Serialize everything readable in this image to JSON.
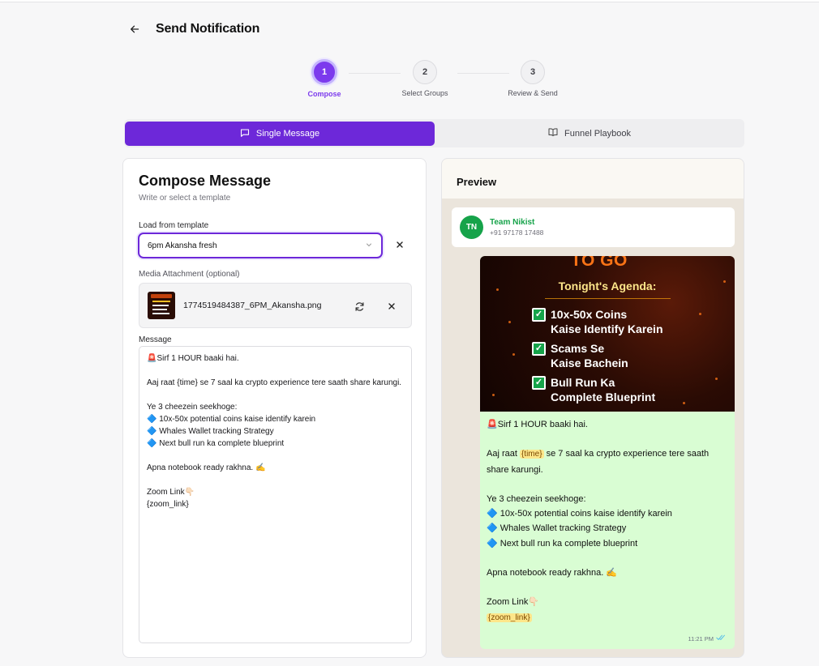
{
  "page": {
    "title": "Send Notification"
  },
  "steps": [
    {
      "number": "1",
      "label": "Compose"
    },
    {
      "number": "2",
      "label": "Select Groups"
    },
    {
      "number": "3",
      "label": "Review & Send"
    }
  ],
  "mode_tabs": {
    "single": "Single Message",
    "funnel": "Funnel Playbook"
  },
  "compose": {
    "heading": "Compose Message",
    "subheading": "Write or select a template",
    "template_label": "Load from template",
    "template_value": "6pm Akansha fresh",
    "media_label": "Media Attachment (optional)",
    "media_filename": "1774519484387_6PM_Akansha.png",
    "message_label": "Message",
    "message_text": "🚨Sirf 1 HOUR baaki hai.\n\nAaj raat {time} se 7 saal ka crypto experience tere saath share karungi.\n\nYe 3 cheezein seekhoge:\n🔷 10x-50x potential coins kaise identify karein\n🔷 Whales Wallet tracking Strategy\n🔷 Next bull run ka complete blueprint\n\nApna notebook ready rakhna. ✍️\n\nZoom Link👇🏻\n{zoom_link}"
  },
  "preview": {
    "heading": "Preview",
    "contact": {
      "initials": "TN",
      "name": "Team Nikist",
      "phone": "+91 97178 17488"
    },
    "poster": {
      "top_text": "TO GO",
      "agenda_title": "Tonight's Agenda:",
      "items": [
        {
          "line1": "10x-50x Coins",
          "line2": "Kaise Identify  Karein"
        },
        {
          "line1": "Scams Se",
          "line2": "Kaise Bachein"
        },
        {
          "line1": "Bull Run Ka",
          "line2": "Complete Blueprint"
        }
      ]
    },
    "message": {
      "line1": "🚨Sirf 1 HOUR baaki hai.",
      "line2_pre": "Aaj raat ",
      "time_var": "{time}",
      "line2_post": " se 7 saal ka crypto experience tere saath share karungi.",
      "line3": "Ye 3 cheezein seekhoge:",
      "bullet1": "🔷 10x-50x potential coins kaise identify karein",
      "bullet2": "🔷 Whales Wallet tracking Strategy",
      "bullet3": "🔷 Next bull run ka complete blueprint",
      "line4": "Apna notebook ready rakhna. ✍️",
      "line5": "Zoom Link👇🏻",
      "zoom_var": "{zoom_link}"
    },
    "time": "11:21 PM"
  },
  "colors": {
    "accent": "#6d28d9",
    "bubble": "#d9fdd3",
    "whatsapp_green": "#16a34a"
  }
}
